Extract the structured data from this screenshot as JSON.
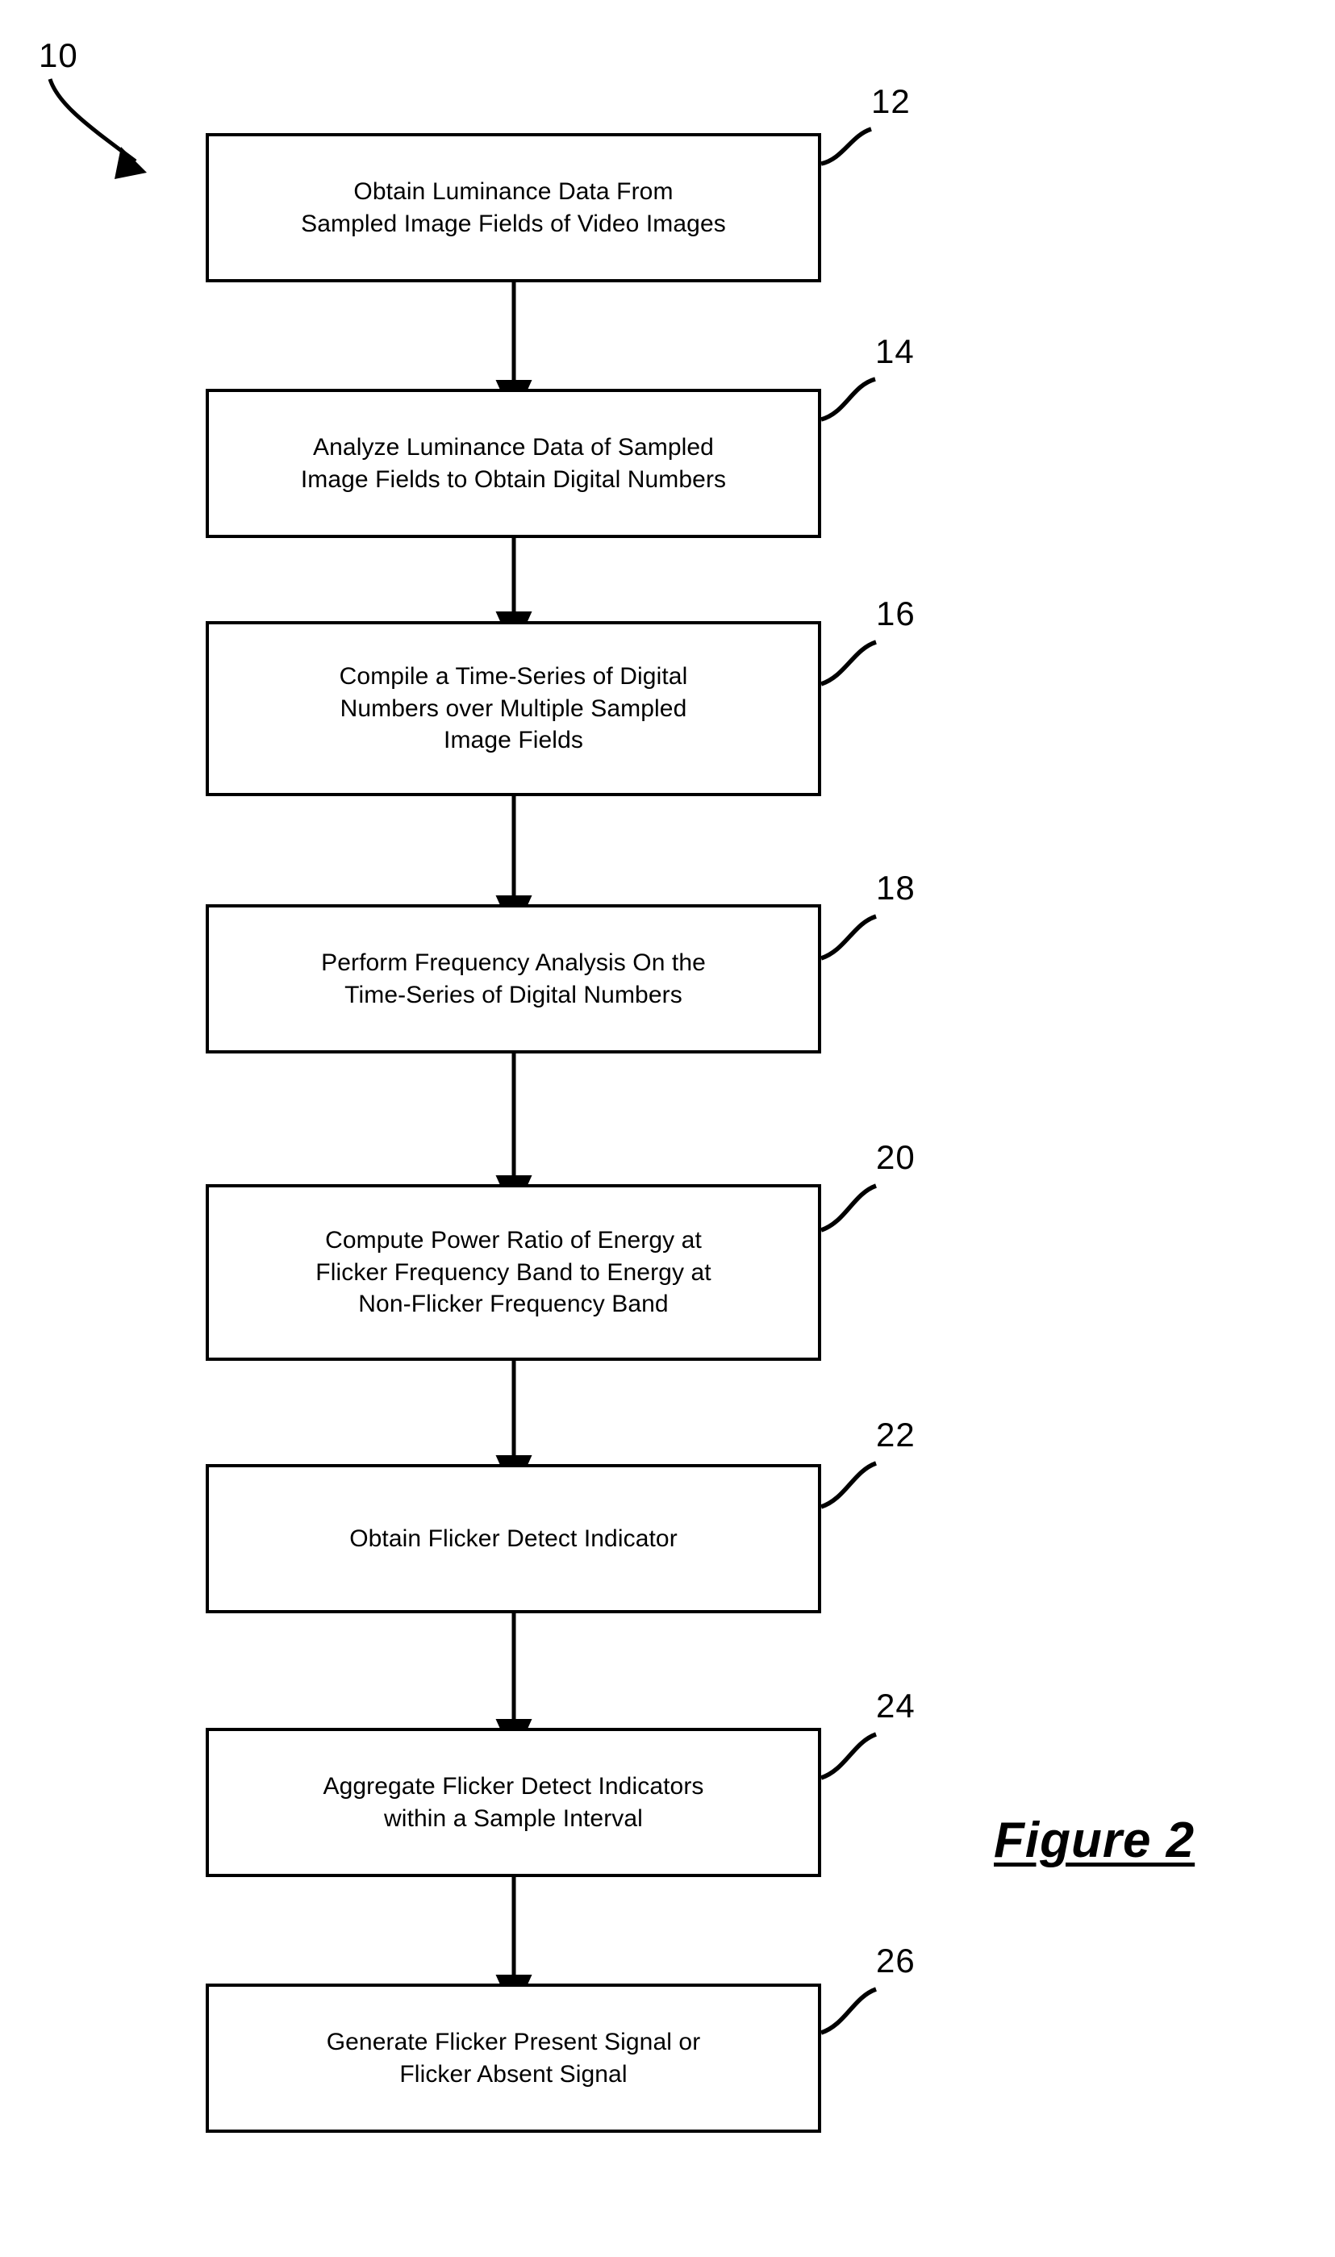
{
  "figure": {
    "caption": "Figure 2",
    "diagram_ref": "10"
  },
  "flowchart": {
    "type": "flowchart",
    "orientation": "top-to-bottom",
    "steps": [
      {
        "ref": "12",
        "text": "Obtain Luminance Data From\nSampled Image Fields of Video Images",
        "lines": [
          "Obtain Luminance Data From",
          "Sampled Image Fields of Video Images"
        ]
      },
      {
        "ref": "14",
        "text": "Analyze Luminance Data of Sampled\nImage Fields to Obtain Digital Numbers",
        "lines": [
          "Analyze Luminance Data of Sampled",
          "Image Fields to Obtain Digital Numbers"
        ]
      },
      {
        "ref": "16",
        "text": "Compile a Time-Series of Digital\nNumbers over Multiple Sampled\nImage Fields",
        "lines": [
          "Compile a Time-Series of Digital",
          "Numbers over Multiple Sampled",
          "Image Fields"
        ]
      },
      {
        "ref": "18",
        "text": "Perform Frequency Analysis On the\nTime-Series of Digital Numbers",
        "lines": [
          "Perform Frequency Analysis On the",
          "Time-Series of Digital Numbers"
        ]
      },
      {
        "ref": "20",
        "text": "Compute Power Ratio of Energy at\nFlicker Frequency Band to Energy at\nNon-Flicker Frequency Band",
        "lines": [
          "Compute Power Ratio of Energy at",
          "Flicker Frequency Band to Energy at",
          "Non-Flicker Frequency Band"
        ]
      },
      {
        "ref": "22",
        "text": "Obtain Flicker Detect Indicator",
        "lines": [
          "Obtain Flicker Detect Indicator"
        ]
      },
      {
        "ref": "24",
        "text": "Aggregate Flicker Detect Indicators\nwithin a Sample Interval",
        "lines": [
          "Aggregate Flicker Detect Indicators",
          "within a Sample Interval"
        ]
      },
      {
        "ref": "26",
        "text": "Generate Flicker Present Signal or\nFlicker Absent Signal",
        "lines": [
          "Generate Flicker Present Signal or",
          "Flicker Absent Signal"
        ]
      }
    ],
    "colors": {
      "stroke": "#000000",
      "fill": "#ffffff",
      "text": "#000000"
    }
  }
}
